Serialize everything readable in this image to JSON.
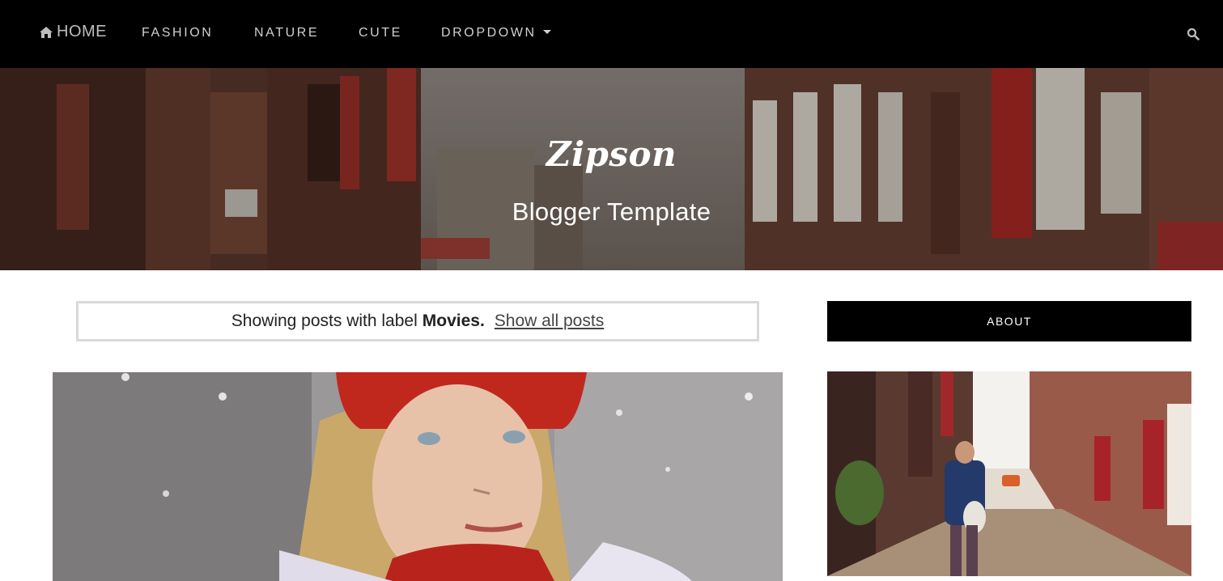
{
  "nav": {
    "home_label": "HOME",
    "items": [
      {
        "label": "FASHION"
      },
      {
        "label": "NATURE"
      },
      {
        "label": "CUTE"
      },
      {
        "label": "DROPDOWN"
      }
    ],
    "icons": {
      "home": "home-icon",
      "search": "search-icon",
      "dropdown": "caret-down-icon"
    }
  },
  "header": {
    "title": "Zipson",
    "subtitle": "Blogger Template"
  },
  "label_filter": {
    "prefix": "Showing posts with label",
    "label": "Movies.",
    "show_all": "Show all posts"
  },
  "sidebar": {
    "about_title": "ABOUT"
  },
  "colors": {
    "nav_bg": "#000000",
    "nav_text": "#d0d0d0",
    "header_text": "#ffffff",
    "label_border": "#d9d9d9",
    "about_bg": "#000000"
  }
}
